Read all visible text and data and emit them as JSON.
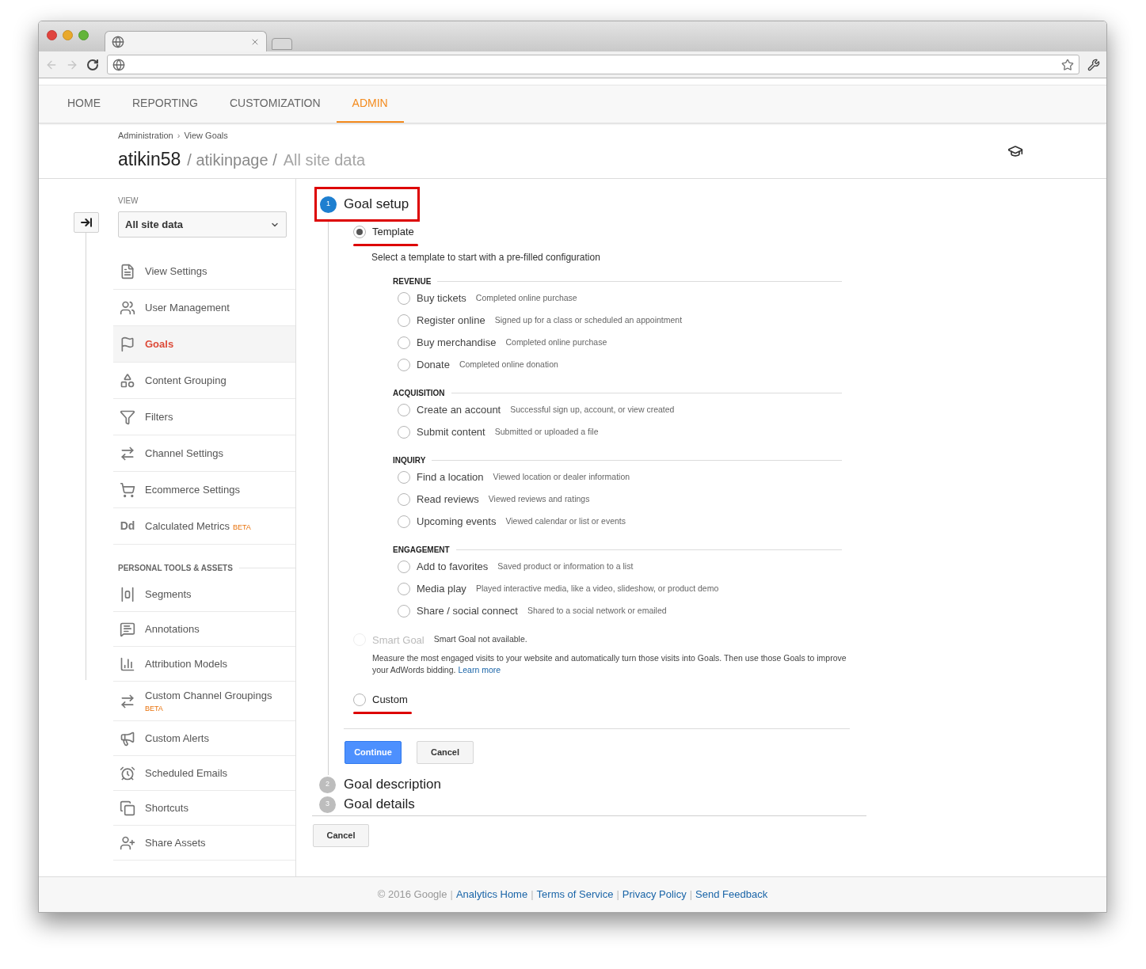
{
  "nav": [
    {
      "label": "HOME",
      "selected": false
    },
    {
      "label": "REPORTING",
      "selected": false
    },
    {
      "label": "CUSTOMIZATION",
      "selected": false
    },
    {
      "label": "ADMIN",
      "selected": true
    }
  ],
  "breadcrumb": {
    "items": [
      "Administration",
      "View Goals"
    ],
    "separator": "›"
  },
  "title": {
    "account": "atikin58",
    "property": "/ atikinpage /",
    "view": "All site data"
  },
  "sidebar": {
    "view_label": "VIEW",
    "view_select": "All site data",
    "items": [
      {
        "label": "View Settings",
        "selected": false
      },
      {
        "label": "User Management",
        "selected": false
      },
      {
        "label": "Goals",
        "selected": true
      },
      {
        "label": "Content Grouping",
        "selected": false
      },
      {
        "label": "Filters",
        "selected": false
      },
      {
        "label": "Channel Settings",
        "selected": false
      },
      {
        "label": "Ecommerce Settings",
        "selected": false
      },
      {
        "label": "Calculated Metrics",
        "selected": false,
        "badge": "BETA",
        "icon_text": "Dd"
      }
    ],
    "section": "PERSONAL TOOLS & ASSETS",
    "personal_items": [
      {
        "label": "Segments",
        "selected": false
      },
      {
        "label": "Annotations",
        "selected": false
      },
      {
        "label": "Attribution Models",
        "selected": false
      },
      {
        "label": "Custom Channel Groupings",
        "selected": false,
        "badge": "BETA"
      },
      {
        "label": "Custom Alerts",
        "selected": false
      },
      {
        "label": "Scheduled Emails",
        "selected": false
      },
      {
        "label": "Shortcuts",
        "selected": false
      },
      {
        "label": "Share Assets",
        "selected": false
      }
    ]
  },
  "steps": [
    {
      "number": "1",
      "title": "Goal setup",
      "selected": true
    },
    {
      "number": "2",
      "title": "Goal description",
      "selected": false
    },
    {
      "number": "3",
      "title": "Goal details",
      "selected": false
    }
  ],
  "goal_setup": {
    "template": {
      "label": "Template",
      "selected": true
    },
    "description": "Select a template to start with a pre-filled configuration",
    "categories": [
      {
        "name": "REVENUE",
        "templates": [
          {
            "label": "Buy tickets",
            "detail": "Completed online purchase",
            "selected": false
          },
          {
            "label": "Register online",
            "detail": "Signed up for a class or scheduled an appointment",
            "selected": false
          },
          {
            "label": "Buy merchandise",
            "detail": "Completed online purchase",
            "selected": false
          },
          {
            "label": "Donate",
            "detail": "Completed online donation",
            "selected": false
          }
        ]
      },
      {
        "name": "ACQUISITION",
        "templates": [
          {
            "label": "Create an account",
            "detail": "Successful sign up, account, or view created",
            "selected": false
          },
          {
            "label": "Submit content",
            "detail": "Submitted or uploaded a file",
            "selected": false
          }
        ]
      },
      {
        "name": "INQUIRY",
        "templates": [
          {
            "label": "Find a location",
            "detail": "Viewed location or dealer information",
            "selected": false
          },
          {
            "label": "Read reviews",
            "detail": "Viewed reviews and ratings",
            "selected": false
          },
          {
            "label": "Upcoming events",
            "detail": "Viewed calendar or list or events",
            "selected": false
          }
        ]
      },
      {
        "name": "ENGAGEMENT",
        "templates": [
          {
            "label": "Add to favorites",
            "detail": "Saved product or information to a list",
            "selected": false
          },
          {
            "label": "Media play",
            "detail": "Played interactive media, like a video, slideshow, or product demo",
            "selected": false
          },
          {
            "label": "Share / social connect",
            "detail": "Shared to a social network or emailed",
            "selected": false
          }
        ]
      }
    ],
    "smart_goal": {
      "label": "Smart Goal",
      "status": "Smart Goal not available.",
      "disabled": true,
      "selected": false,
      "description": "Measure the most engaged visits to your website and automatically turn those visits into Goals. Then use those Goals to improve your AdWords bidding.",
      "link": "Learn more"
    },
    "custom": {
      "label": "Custom",
      "selected": false
    },
    "buttons": {
      "continue": "Continue",
      "cancel": "Cancel"
    }
  },
  "cancel_button": "Cancel",
  "footer": [
    {
      "kind": "text",
      "text": "© 2016 Google"
    },
    {
      "kind": "separator",
      "text": "|"
    },
    {
      "kind": "link",
      "text": "Analytics Home"
    },
    {
      "kind": "separator",
      "text": "|"
    },
    {
      "kind": "link",
      "text": "Terms of Service"
    },
    {
      "kind": "separator",
      "text": "|"
    },
    {
      "kind": "link",
      "text": "Privacy Policy"
    },
    {
      "kind": "separator",
      "text": "|"
    },
    {
      "kind": "link",
      "text": "Send Feedback"
    }
  ]
}
